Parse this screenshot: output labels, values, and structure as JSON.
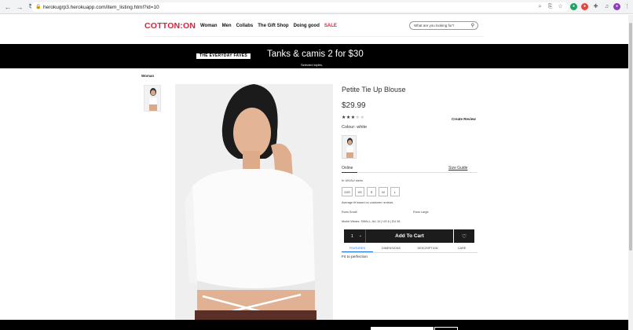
{
  "browser": {
    "url": "herokugrp3.herokuapp.com/item_listing.html?id=10"
  },
  "header": {
    "logo": "COTTON:ON",
    "nav": [
      "Woman",
      "Men",
      "Collabs",
      "The Gift Shop",
      "Doing good",
      "SALE"
    ],
    "search_placeholder": "What are you looking for?"
  },
  "promo": {
    "tag": "THE EVERYDAY FAVES",
    "headline": "Tanks & camis 2 for $30",
    "subtext": "Selected styles."
  },
  "breadcrumb": "Woman",
  "product": {
    "title": "Petite Tie Up Blouse",
    "price": "$29.99",
    "rating": 3,
    "rating_max": 5,
    "create_review": "Create Review",
    "colour": "Colour: white",
    "online_label": "Online",
    "size_guide": "Size Guide",
    "sizes_label": "In UK/AU sizes",
    "sizes": [
      "2XS",
      "XS",
      "S",
      "M",
      "L"
    ],
    "reviews_note": "Average fit based on customer reviews",
    "fit_small": "Runs Small",
    "fit_large": "Runs Large",
    "model_wears": "Model Wears: SMALL; AU 10 | US 6 | EU 36",
    "qty": "1",
    "add_to_cart": "Add To Cart",
    "tabs": [
      "FEATURES",
      "DIMENSIONS",
      "DESCRIPTION",
      "CARE"
    ],
    "feature_text": "Fit to perfection"
  },
  "colors": {
    "brand_red": "#e11f3a",
    "promo_bg": "#000000",
    "button_bg": "#1c1c1c",
    "tab_active": "#1a73e8"
  }
}
